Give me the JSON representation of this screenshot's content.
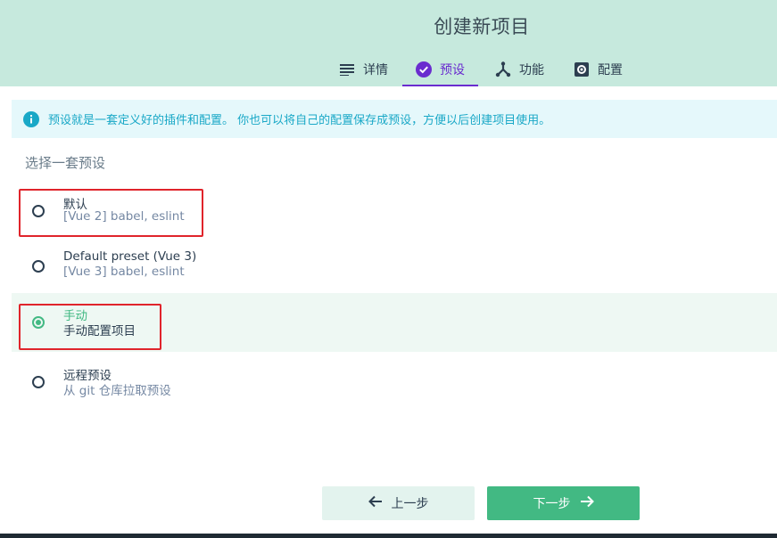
{
  "header": {
    "title": "创建新项目",
    "tabs": [
      {
        "label": "详情",
        "icon": "list-icon",
        "active": false
      },
      {
        "label": "预设",
        "icon": "check-circle-icon",
        "active": true
      },
      {
        "label": "功能",
        "icon": "branch-icon",
        "active": false
      },
      {
        "label": "配置",
        "icon": "settings-icon",
        "active": false
      }
    ]
  },
  "info": {
    "text": "预设就是一套定义好的插件和配置。 你也可以将自己的配置保存成预设，方便以后创建项目使用。",
    "icon": "info-icon"
  },
  "section_title": "选择一套预设",
  "presets": [
    {
      "name": "默认",
      "desc": "[Vue 2] babel, eslint",
      "selected": false
    },
    {
      "name": "Default preset (Vue 3)",
      "desc": "[Vue 3] babel, eslint",
      "selected": false
    },
    {
      "name": "手动",
      "desc": "手动配置项目",
      "selected": true
    },
    {
      "name": "远程预设",
      "desc": "从 git 仓库拉取预设",
      "selected": false
    }
  ],
  "buttons": {
    "prev_label": "上一步",
    "next_label": "下一步"
  },
  "colors": {
    "header_bg": "#c6e9dd",
    "accent_purple": "#6a2ccf",
    "accent_green": "#42b983",
    "info_text": "#19a8c7",
    "highlight_red": "#e0242b"
  }
}
